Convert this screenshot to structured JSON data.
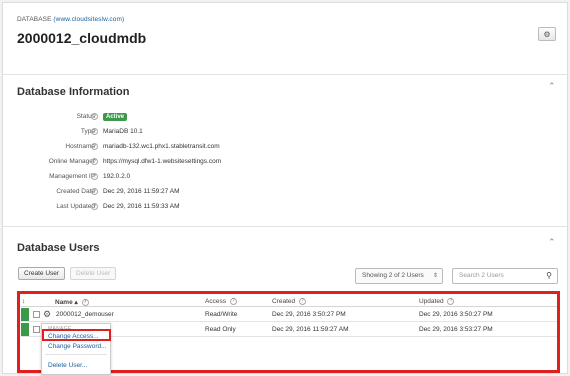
{
  "header": {
    "eyebrow_prefix": "DATABASE",
    "eyebrow_link": "(www.cloudsiteslw.com)",
    "title": "2000012_cloudmdb",
    "settings_icon": "gear-icon"
  },
  "info": {
    "title": "Database Information",
    "collapse_icon": "chevron-up-icon",
    "rows": [
      {
        "label": "Status",
        "value": "Active"
      },
      {
        "label": "Type",
        "value": "MariaDB 10.1"
      },
      {
        "label": "Hostname",
        "value": "mariadb-132.wc1.phx1.stabletransit.com"
      },
      {
        "label": "Online Manager",
        "value": "https://mysql.dfw1-1.websitesettings.com"
      },
      {
        "label": "Management IP",
        "value": "192.0.2.0"
      },
      {
        "label": "Created Date",
        "value": "Dec 29, 2016 11:59:27 AM"
      },
      {
        "label": "Last Updated",
        "value": "Dec 29, 2016 11:59:33 AM"
      }
    ],
    "help_glyph": "?"
  },
  "users": {
    "title": "Database Users",
    "collapse_icon": "chevron-up-icon",
    "create_label": "Create User",
    "delete_label": "Delete User",
    "showing_label": "Showing 2 of 2 Users",
    "search_placeholder": "Search 2 Users",
    "columns": {
      "sort_glyph": "↕",
      "name": "Name",
      "access": "Access",
      "created": "Created",
      "updated": "Updated"
    },
    "rows": [
      {
        "name": "2000012_demouser",
        "access": "Read/Write",
        "created": "Dec 29, 2016 3:50:27 PM",
        "updated": "Dec 29, 2016 3:50:27 PM"
      },
      {
        "name": "",
        "access": "Read Only",
        "created": "Dec 29, 2016 11:59:27 AM",
        "updated": "Dec 29, 2016 3:53:27 PM"
      }
    ]
  },
  "menu": {
    "heading": "MANAGE",
    "items": [
      "Change Access...",
      "Change Password...",
      "Delete User..."
    ]
  },
  "colors": {
    "active_badge": "#3a9a4a",
    "highlight": "#e01f1f",
    "link": "#1a5fa0"
  }
}
